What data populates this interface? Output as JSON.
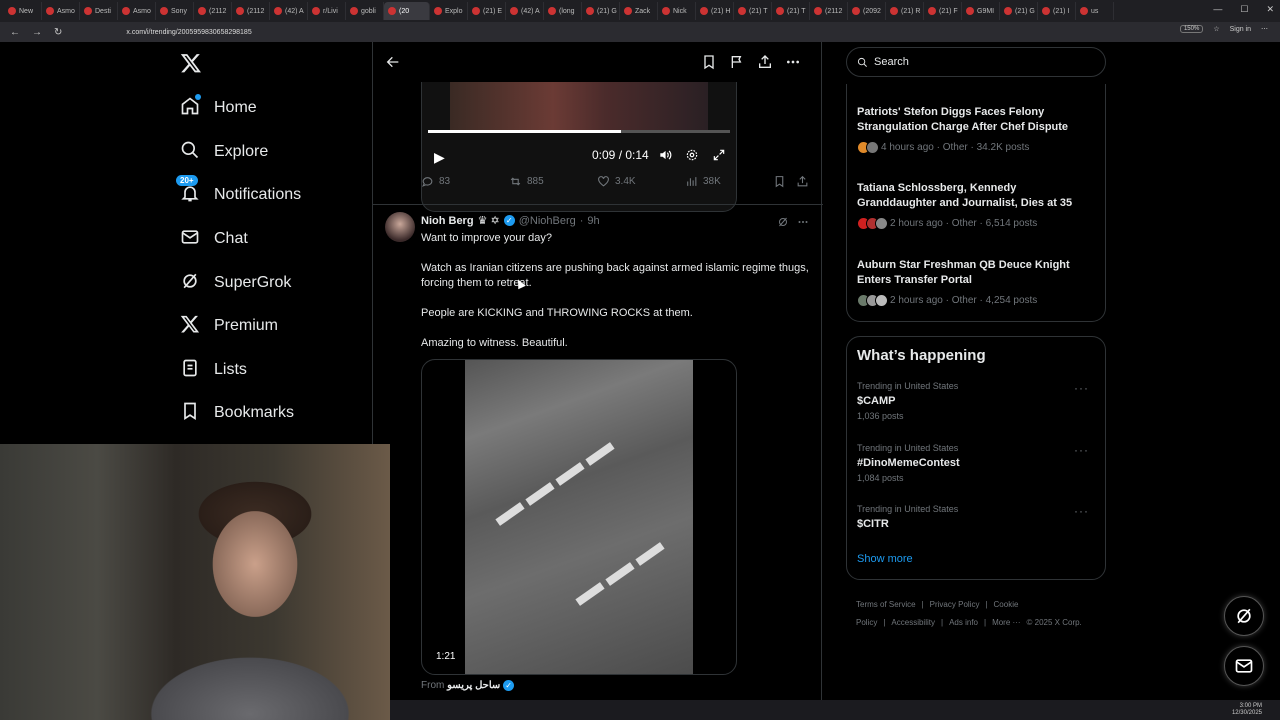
{
  "browser": {
    "tabs": [
      "New",
      "Asmo",
      "Desti",
      "Asmo",
      "Sony",
      "(2112",
      "(2112",
      "(42) A",
      "r/Livi",
      "gobli",
      "(20",
      "Explo",
      "(21) E",
      "(42) A",
      "(long",
      "(21) G",
      "Zack",
      "Nick",
      "(21) H",
      "(21) T",
      "(21) T",
      "(2112",
      "(2092",
      "(21) R",
      "(21) F",
      "G9MI",
      "(21) G",
      "(21) I",
      "us"
    ],
    "active_tab_index": 10,
    "url": "x.com/i/trending/2005959830658298185",
    "zoom": "150%",
    "sign_in": "Sign in"
  },
  "nav": {
    "notifications_badge": "20+",
    "items": [
      {
        "label": "Home",
        "icon": "home-icon"
      },
      {
        "label": "Explore",
        "icon": "search-icon"
      },
      {
        "label": "Notifications",
        "icon": "bell-icon"
      },
      {
        "label": "Chat",
        "icon": "mail-icon"
      },
      {
        "label": "SuperGrok",
        "icon": "grok-icon"
      },
      {
        "label": "Premium",
        "icon": "x-logo-icon"
      },
      {
        "label": "Lists",
        "icon": "list-icon"
      },
      {
        "label": "Bookmarks",
        "icon": "bookmark-icon"
      }
    ]
  },
  "video1": {
    "time": "0:09 / 0:14",
    "progress": 0.64
  },
  "post1_actions": {
    "replies": "83",
    "reposts": "885",
    "likes": "3.4K",
    "views": "38K"
  },
  "post2": {
    "name": "Nioh Berg",
    "emoji": "♛ ✡",
    "handle": "@NiohBerg",
    "time": "9h",
    "lines": [
      "Want to improve your day?",
      "Watch as Iranian citizens are pushing back against armed islamic regime thugs, forcing them to retreat.",
      "People are KICKING and THROWING ROCKS at them.",
      "Amazing to witness. Beautiful."
    ],
    "video_duration": "1:21",
    "from_label": "From",
    "from_name": "ساحل پریسو"
  },
  "search": {
    "placeholder": "Search"
  },
  "news": [
    {
      "title": "Patriots' Stefon Diggs Faces Felony Strangulation Charge After Chef Dispute",
      "meta": "4 hours ago · Other · 34.2K posts"
    },
    {
      "title": "Tatiana Schlossberg, Kennedy Granddaughter and Journalist, Dies at 35",
      "meta": "2 hours ago · Other · 6,514 posts"
    },
    {
      "title": "Auburn Star Freshman QB Deuce Knight Enters Transfer Portal",
      "meta": "2 hours ago · Other · 4,254 posts"
    }
  ],
  "happening": {
    "title": "What’s happening",
    "trends": [
      {
        "context": "Trending in United States",
        "name": "$CAMP",
        "posts": "1,036 posts"
      },
      {
        "context": "Trending in United States",
        "name": "#DinoMemeContest",
        "posts": "1,084 posts"
      },
      {
        "context": "Trending in United States",
        "name": "$CITR",
        "posts": ""
      }
    ],
    "show_more": "Show more"
  },
  "footer": {
    "links": [
      "Terms of Service",
      "|",
      "Privacy Policy",
      "|",
      "Cookie Policy",
      "|",
      "Accessibility",
      "|",
      "Ads info",
      "|",
      "More ···",
      "© 2025 X Corp."
    ]
  },
  "taskbar": {
    "time": "3:00 PM",
    "date": "12/30/2025"
  },
  "colors": {
    "accent": "#1d9bf0",
    "border": "#2f3336",
    "muted": "#71767b"
  }
}
